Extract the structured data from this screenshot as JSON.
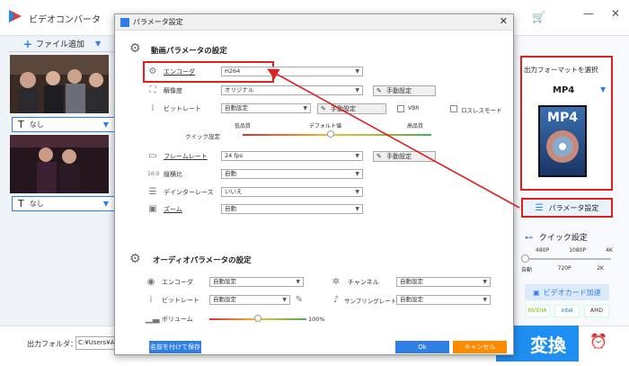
{
  "app": {
    "title": "ビデオコンバータ"
  },
  "left": {
    "add_file": "ファイル追加",
    "subtitle1": "なし",
    "subtitle2": "なし",
    "output_label": "出力フォルダ：",
    "output_path": "C:¥Users¥Admi"
  },
  "right": {
    "format_title": "出力フォーマットを選択",
    "format_name": "MP4",
    "format_icon_text": "MP4",
    "param_button": "パラメータ設定",
    "quick_title": "クイック設定",
    "quick_top": [
      "480P",
      "1080P",
      "4K"
    ],
    "quick_bottom": [
      "自動",
      "720P",
      "2K"
    ],
    "gpu": "ビデオカード加速",
    "vendors": [
      "NVIDIA",
      "intel",
      "AMD"
    ],
    "convert": "変換"
  },
  "dialog": {
    "title": "パラメータ設定",
    "video_section": "動画パラメータの設定",
    "video": {
      "encoder_label": "エンコーダ",
      "encoder_value": "H264",
      "resolution_label": "解像度",
      "resolution_value": "オリジナル",
      "manual1": "手動設定",
      "bitrate_label": "ビットレート",
      "bitrate_value": "自動設定",
      "manual2": "手動設定",
      "vbr": "VBR",
      "lossless": "ロスレスモード",
      "quick_label": "クイック設定",
      "low_quality": "低品質",
      "default_value": "デフォルト値",
      "high_quality": "高品質",
      "framerate_label": "フレームレート",
      "framerate_value": "24 fps",
      "manual3": "手動設定",
      "aspect_label": "縦横比",
      "aspect_value": "自動",
      "deinterlace_label": "デインターレース",
      "deinterlace_value": "いいえ",
      "zoom_label": "ズーム",
      "zoom_value": "自動"
    },
    "audio_section": "オーディオパラメータの設定",
    "audio": {
      "encoder_label": "エンコーダ",
      "encoder_value": "自動設定",
      "channel_label": "チャンネル",
      "channel_value": "自動設定",
      "bitrate_label": "ビットレート",
      "bitrate_value": "自動設定",
      "samplerate_label": "サンプリングレート",
      "samplerate_value": "自動設定",
      "volume_label": "ボリューム",
      "volume_value": "100%"
    },
    "footer": {
      "save_as": "名前を付けて保存",
      "ok": "Ok",
      "cancel": "キャンセル"
    }
  },
  "colors": {
    "accent": "#2f7fe6",
    "highlight": "#e02020",
    "cancel": "#ff8a00"
  }
}
